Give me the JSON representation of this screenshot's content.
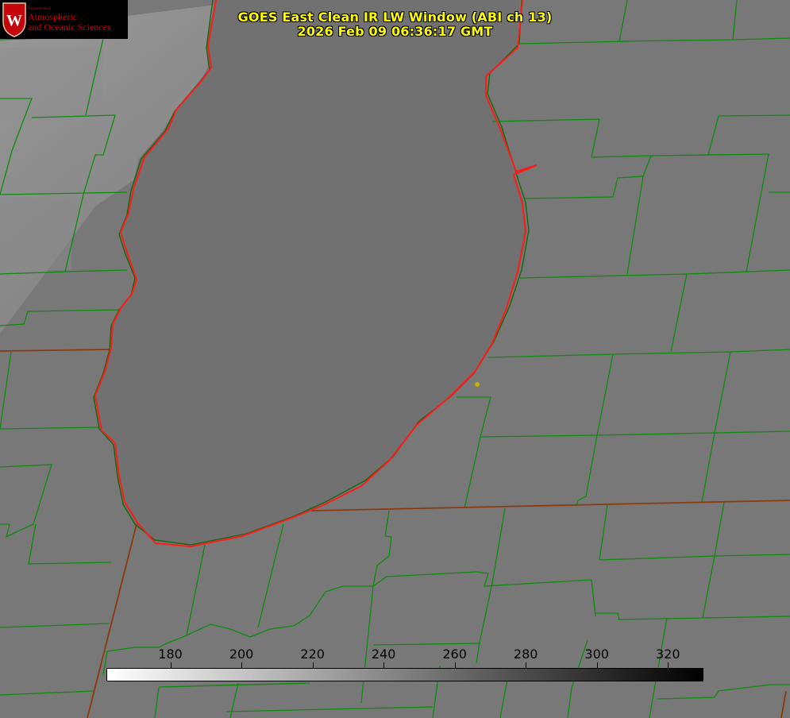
{
  "title": {
    "line1": "GOES East Clean IR LW Window (ABI ch 13)",
    "line2": "2026 Feb 09 06:36:17 GMT"
  },
  "logo": {
    "dept": "Department of",
    "line1": "Atmospheric",
    "line2": "and Oceanic Sciences",
    "crest_letter": "W"
  },
  "colorbar": {
    "range": [
      162,
      330
    ],
    "ticks": [
      "180",
      "200",
      "220",
      "240",
      "260",
      "280",
      "300",
      "320"
    ],
    "colormap": "white-to-black"
  },
  "colors": {
    "land": "#7a7a7a",
    "lake": "#6f6f6f",
    "county_lines": "#0f8a0f",
    "shoreline": "#ff1a1a",
    "state_lines": "#8a3a10",
    "station_marker": "#c8b400",
    "title_text": "#ffff00"
  }
}
